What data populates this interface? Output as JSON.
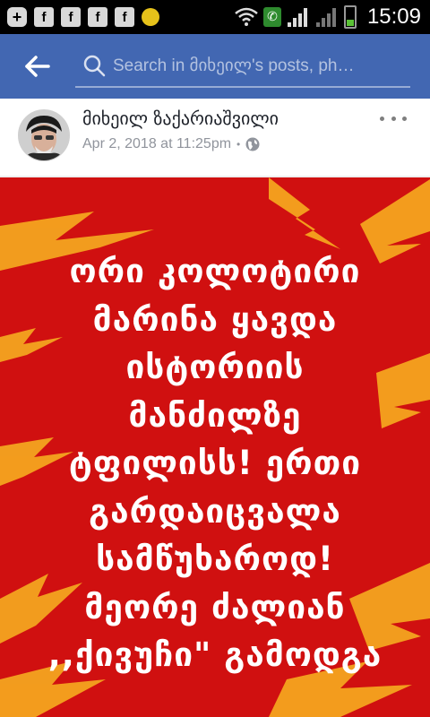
{
  "status_bar": {
    "time": "15:09",
    "notification_icons": [
      "plus-icon",
      "facebook-icon",
      "facebook-icon",
      "facebook-icon",
      "facebook-icon",
      "coin-icon"
    ],
    "right_icons": [
      "wifi-icon",
      "phone-icon",
      "signal-icon",
      "battery-icon"
    ]
  },
  "header": {
    "search_placeholder": "Search in მიხეილ's posts, ph…",
    "color": "#4267b2"
  },
  "post": {
    "author": "მიხეილ ზაქარიაშვილი",
    "timestamp": "Apr 2, 2018 at 11:25pm",
    "separator": "•",
    "privacy_icon": "globe-icon",
    "more_icon": "more-horizontal-icon",
    "image": {
      "background": "#d01010",
      "bolt_color": "#f5a623",
      "lines": [
        "ორი კოლოტირი",
        "მარინა ყავდა",
        "ისტორიის",
        "მანძილზე",
        "ტფილისს! ერთი",
        "გარდაიცვალა",
        "სამწუხაროდ!",
        "მეორე ძალიან",
        ",,ქივუჩი\" გამოდგა"
      ]
    }
  }
}
